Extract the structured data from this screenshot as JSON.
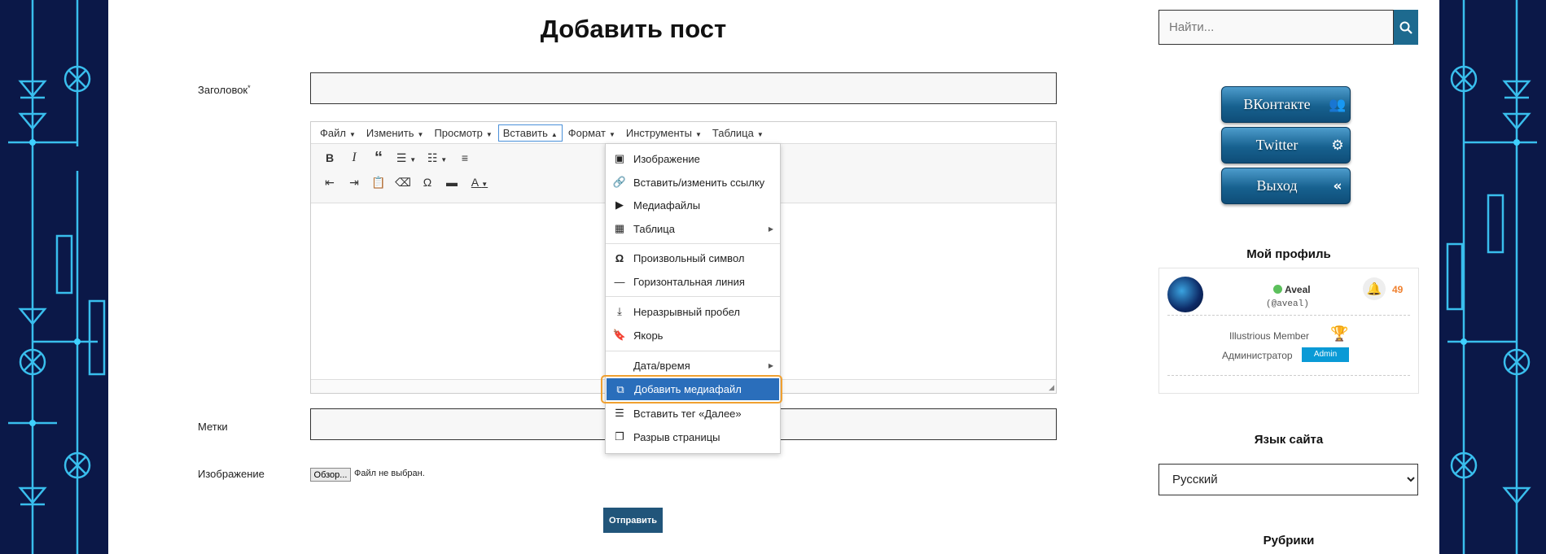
{
  "page": {
    "title": "Добавить пост",
    "labels": {
      "heading_field": "Заголовок",
      "required_mark": "*",
      "tags": "Метки",
      "image": "Изображение"
    },
    "file_input": {
      "button_label": "Обзор...",
      "status": "Файл не выбран."
    },
    "submit_label": "Отправить"
  },
  "editor": {
    "menubar": [
      {
        "label": "Файл"
      },
      {
        "label": "Изменить"
      },
      {
        "label": "Просмотр"
      },
      {
        "label": "Вставить",
        "open": true
      },
      {
        "label": "Формат"
      },
      {
        "label": "Инструменты"
      },
      {
        "label": "Таблица"
      }
    ],
    "toolbar_icons": [
      "bold-icon",
      "italic-icon",
      "blockquote-icon",
      "bullet-list-icon",
      "numbered-list-icon",
      "align-left-icon",
      "outdent-icon",
      "indent-icon",
      "paste-text-icon",
      "clear-format-icon",
      "special-char-icon",
      "horizontal-line-icon",
      "text-color-icon"
    ],
    "insert_menu": {
      "items": [
        {
          "label": "Изображение",
          "icon": "image-icon"
        },
        {
          "label": "Вставить/изменить ссылку",
          "icon": "link-icon"
        },
        {
          "label": "Медиафайлы",
          "icon": "media-icon"
        },
        {
          "label": "Таблица",
          "icon": "table-icon",
          "submenu": true
        },
        {
          "label": "Произвольный символ",
          "icon": "omega-icon"
        },
        {
          "label": "Горизонтальная линия",
          "icon": "horizontal-line-icon"
        },
        {
          "label": "Неразрывный пробел",
          "icon": "nonbreaking-space-icon"
        },
        {
          "label": "Якорь",
          "icon": "bookmark-icon"
        },
        {
          "label": "Дата/время",
          "icon": "",
          "submenu": true
        },
        {
          "label": "Добавить медиафайл",
          "icon": "add-media-icon",
          "highlighted": true
        },
        {
          "label": "Вставить тег «Далее»",
          "icon": "read-more-icon"
        },
        {
          "label": "Разрыв страницы",
          "icon": "page-break-icon"
        }
      ]
    }
  },
  "sidebar": {
    "search_placeholder": "Найти...",
    "social_buttons": [
      {
        "label": "ВКонтакте",
        "icon": "vk-group-icon"
      },
      {
        "label": "Twitter",
        "icon": "twitter-gears-icon"
      },
      {
        "label": "Выход",
        "icon": "double-chevron-left-icon"
      }
    ],
    "profile": {
      "title": "Мой профиль",
      "username": "Aveal",
      "handle": "(@aveal)",
      "notifications": "49",
      "rank": "Illustrious Member",
      "role": "Администратор",
      "role_badge": "Admin"
    },
    "language": {
      "title": "Язык сайта",
      "selected": "Русский"
    },
    "categories_title": "Рубрики"
  },
  "colors": {
    "accent": "#21557a",
    "menu_highlight": "#2a6ebb",
    "highlight_ring": "#f0a030",
    "notification": "#f0812f",
    "online": "#5cc05c",
    "admin_badge": "#0a9ad6"
  }
}
